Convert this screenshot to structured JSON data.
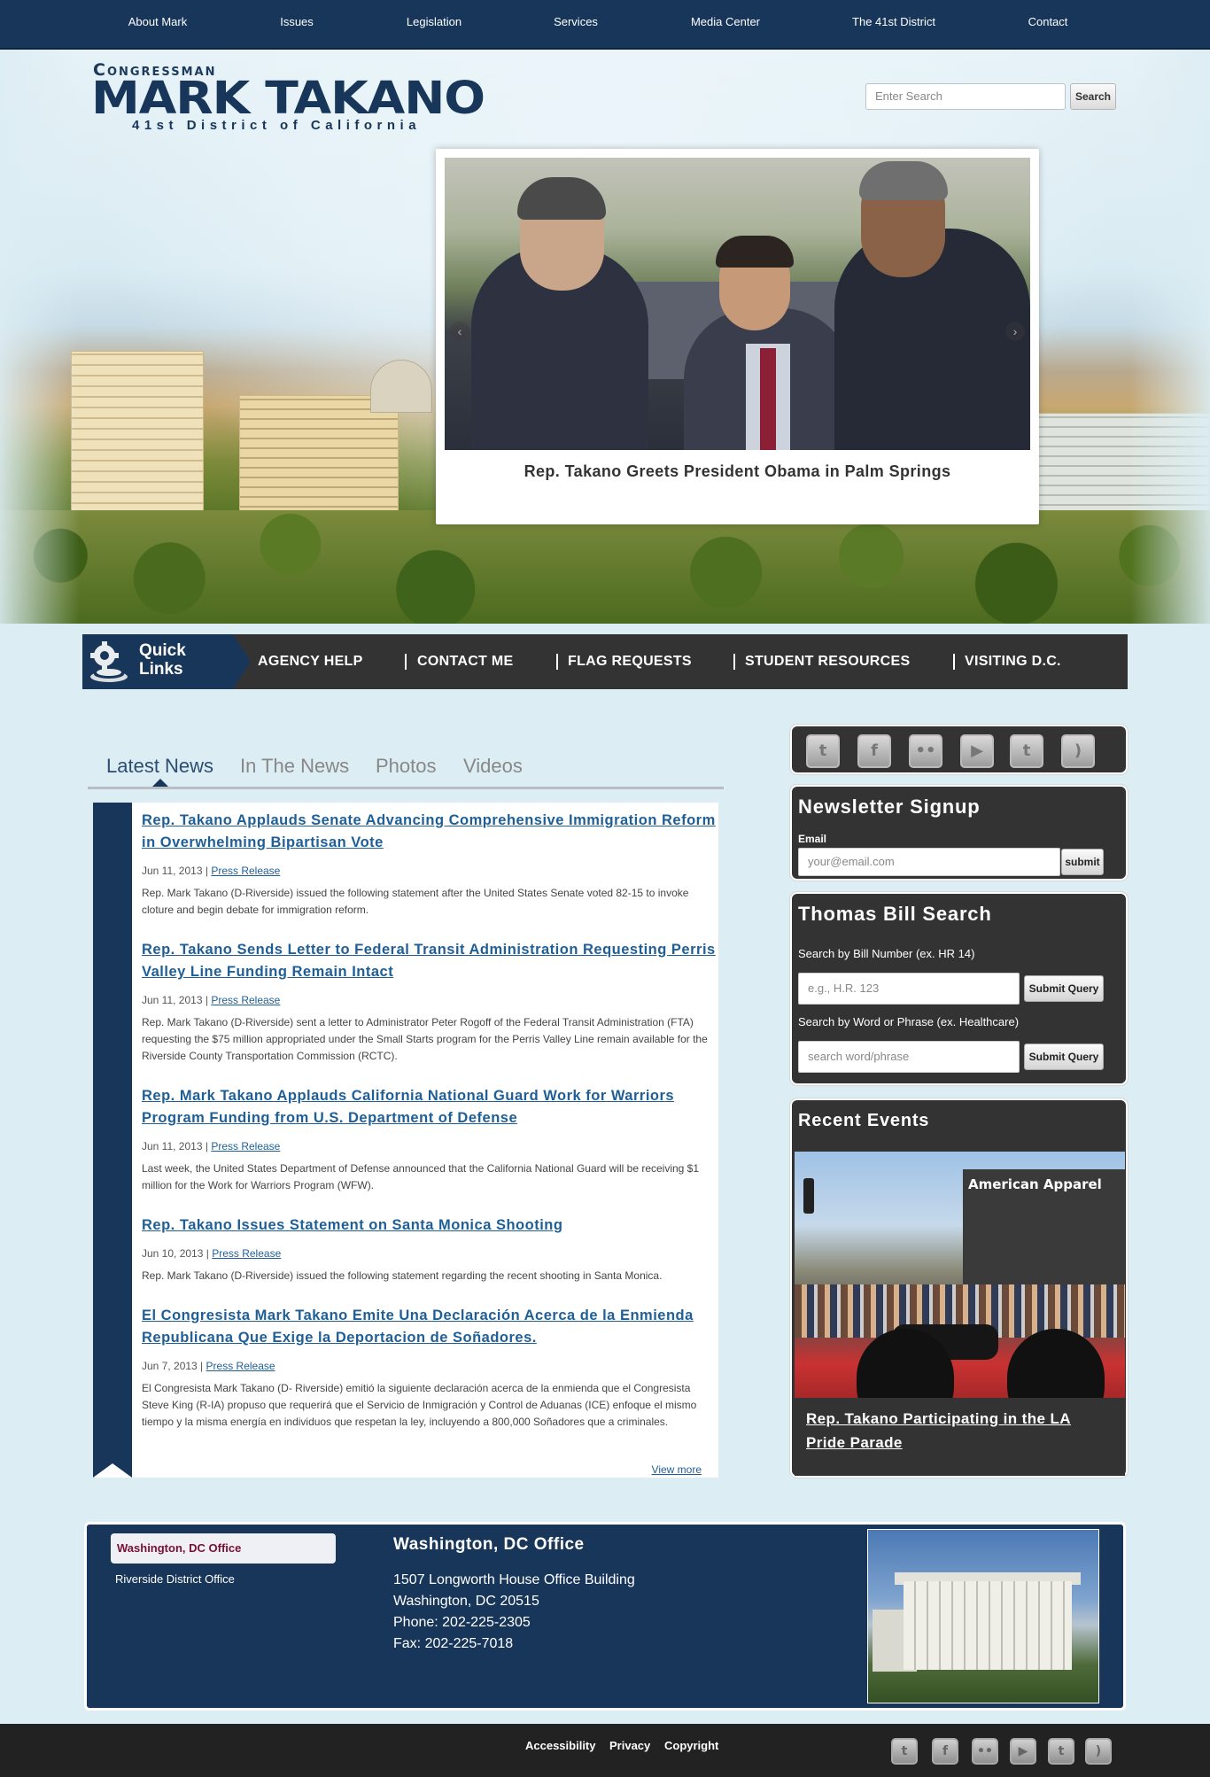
{
  "nav": {
    "items": [
      "About Mark",
      "Issues",
      "Legislation",
      "Services",
      "Media Center",
      "The 41st District",
      "Contact"
    ]
  },
  "logo": {
    "line1": "Congressman",
    "line2": "MARK TAKANO",
    "line3": "41st District of California"
  },
  "search": {
    "placeholder": "Enter Search",
    "button": "Search"
  },
  "slideshow": {
    "caption": "Rep. Takano Greets President Obama in Palm Springs",
    "prev_icon": "chevron-left-icon",
    "next_icon": "chevron-right-icon"
  },
  "quick_links": {
    "title_line1": "Quick",
    "title_line2": "Links",
    "items": [
      "AGENCY HELP",
      "CONTACT ME",
      "FLAG REQUESTS",
      "STUDENT RESOURCES",
      "VISITING D.C."
    ]
  },
  "news_tabs": [
    "Latest News",
    "In The News",
    "Photos",
    "Videos"
  ],
  "news": [
    {
      "title": "Rep. Takano Applauds Senate Advancing Comprehensive Immigration Reform in Overwhelming Bipartisan Vote",
      "date": "Jun 11, 2013",
      "category": "Press Release",
      "summary": "Rep. Mark Takano (D-Riverside) issued the following statement after the United States Senate voted 82-15 to invoke cloture and begin debate for immigration reform."
    },
    {
      "title": "Rep. Takano Sends Letter to Federal Transit Administration Requesting Perris Valley Line Funding Remain Intact",
      "date": "Jun 11, 2013",
      "category": "Press Release",
      "summary": "Rep. Mark Takano (D-Riverside) sent a letter to Administrator Peter Rogoff of the Federal Transit Administration (FTA) requesting the $75 million appropriated under the Small Starts program for the Perris Valley Line remain available for the Riverside County Transportation Commission (RCTC)."
    },
    {
      "title": "Rep. Mark Takano Applauds California National Guard Work for Warriors Program Funding from U.S. Department of Defense",
      "date": "Jun 11, 2013",
      "category": "Press Release",
      "summary": "Last week, the United States Department of Defense announced that the California National Guard will be receiving $1 million for the Work for Warriors Program (WFW)."
    },
    {
      "title": "Rep. Takano Issues Statement on Santa Monica Shooting",
      "date": "Jun 10, 2013",
      "category": "Press Release",
      "summary": "Rep. Mark Takano (D-Riverside) issued the following statement regarding the recent shooting in Santa Monica."
    },
    {
      "title": "El Congresista Mark Takano Emite Una Declaración Acerca de la Enmienda Republicana Que Exige la Deportacion de Soñadores.",
      "date": "Jun 7, 2013",
      "category": "Press Release",
      "summary": "El Congresista Mark Takano (D- Riverside) emitió la siguiente declaración acerca de la enmienda que el Congresista Steve King (R-IA) propuso que requerirá que el Servicio de Inmigración y Control de Aduanas (ICE) enfoque el mismo tiempo y la misma energía en individuos que respetan la ley, incluyendo a 800,000 Soñadores que a criminales."
    }
  ],
  "view_more": "View more",
  "social_icons": [
    "twitter-icon",
    "facebook-icon",
    "flickr-icon",
    "youtube-icon",
    "tumblr-icon",
    "rss-icon"
  ],
  "newsletter": {
    "title": "Newsletter Signup",
    "email_label": "Email",
    "email_placeholder": "your@email.com",
    "submit": "submit"
  },
  "thomas": {
    "title": "Thomas Bill Search",
    "bill_label": "Search by Bill Number (ex. HR 14)",
    "bill_placeholder": "e.g., H.R. 123",
    "bill_submit": "Submit Query",
    "word_label": "Search by Word or Phrase (ex. Healthcare)",
    "word_placeholder": "search word/phrase",
    "word_submit": "Submit Query"
  },
  "events": {
    "title": "Recent Events",
    "photo_sign": "American Apparel",
    "caption": "Rep. Takano Participating in the LA Pride Parade"
  },
  "offices": {
    "tabs": [
      "Washington, DC Office",
      "Riverside District Office"
    ],
    "title": "Washington, DC Office",
    "lines": [
      "1507 Longworth House Office Building",
      "Washington, DC 20515",
      "Phone: 202-225-2305",
      "Fax: 202-225-7018"
    ]
  },
  "footer": {
    "links": [
      "Accessibility",
      "Privacy",
      "Copyright"
    ]
  },
  "colors": {
    "navy": "#17365a",
    "dark_panel": "#333333",
    "link_blue": "#1f5f97",
    "office_tab_text": "#7a1030"
  }
}
